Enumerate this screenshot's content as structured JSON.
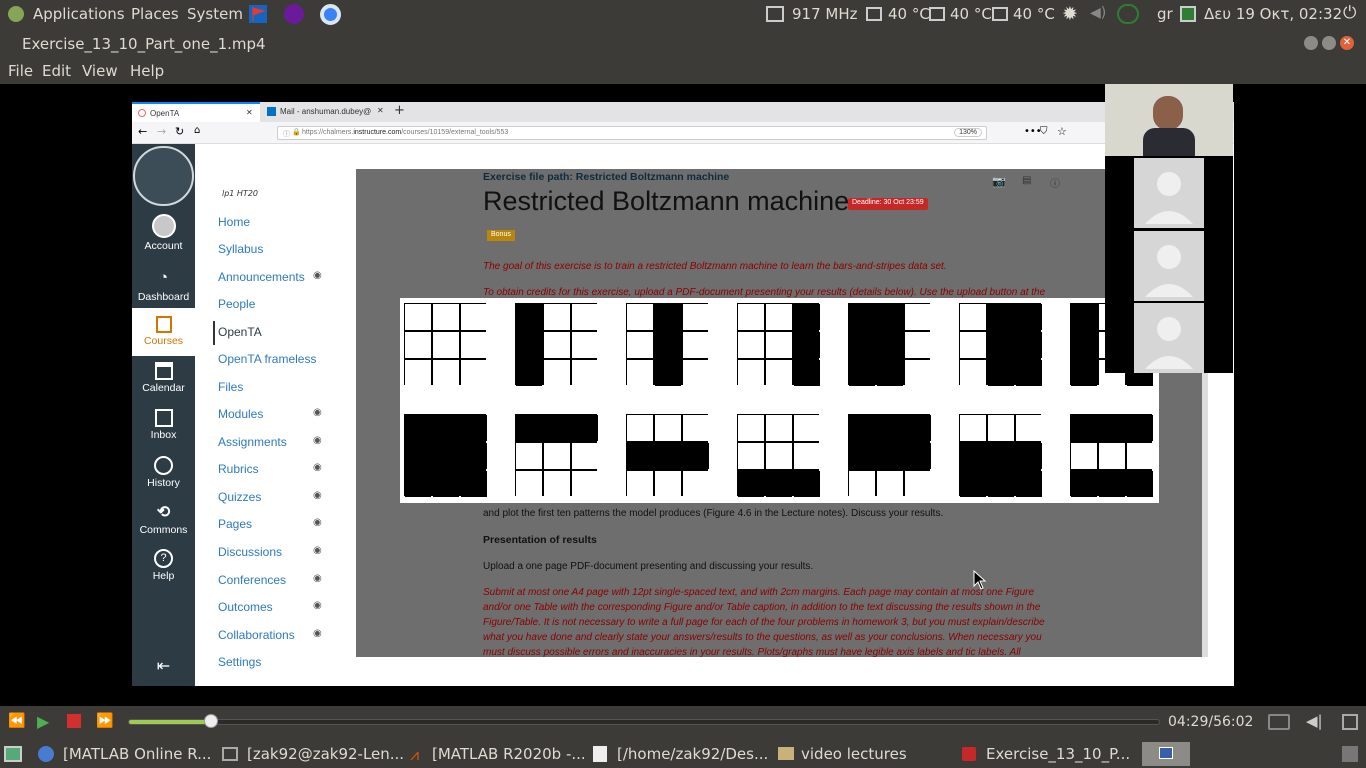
{
  "topbar": {
    "applications": "Applications",
    "places": "Places",
    "system": "System",
    "cpu": "917 MHz",
    "temp1": "40 °C",
    "temp2": "40 °C",
    "temp3": "40 °C",
    "lang": "gr",
    "datetime": "Δευ 19 Οκτ, 02:32"
  },
  "window": {
    "title": "Exercise_13_10_Part_one_1.mp4"
  },
  "menu": {
    "file": "File",
    "edit": "Edit",
    "view": "View",
    "help": "Help"
  },
  "browser": {
    "tab1": "OpenTA",
    "tab2": "Mail - anshuman.dubey@",
    "url_prefix": "https://chalmers.",
    "url_host": "instructure.com",
    "url_path": "/courses/10159/external_tools/553",
    "zoom": "130%"
  },
  "globalnav": {
    "account": "Account",
    "dashboard": "Dashboard",
    "courses": "Courses",
    "calendar": "Calendar",
    "inbox": "Inbox",
    "history": "History",
    "commons": "Commons",
    "help": "Help"
  },
  "coursenav": {
    "term": "lp1 HT20",
    "items": [
      "Home",
      "Syllabus",
      "Announcements",
      "People",
      "OpenTA",
      "OpenTA frameless",
      "Files",
      "Modules",
      "Assignments",
      "Rubrics",
      "Quizzes",
      "Pages",
      "Discussions",
      "Conferences",
      "Outcomes",
      "Collaborations",
      "Settings"
    ]
  },
  "exercise": {
    "path": "Exercise file path: Restricted Boltzmann machine",
    "title": "Restricted Boltzmann machine",
    "deadline": "Deadline: 30 Oct 23:59",
    "bonus": "Bonus",
    "goal": "The goal of this exercise is to train a restricted Boltzmann machine to learn the bars-and-stripes data set.",
    "credits": "To obtain credits for this exercise, upload a PDF-document presenting your results (details below). Use the upload button at the",
    "plot": "and plot the first ten patterns the model produces (Figure 4.6 in the Lecture notes). Discuss your results.",
    "presentation_heading": "Presentation of results",
    "upload": "Upload a one page PDF-document presenting and discussing your results.",
    "submit1": "Submit at most one A4 page with 12pt single-spaced text, and with 2cm margins. Each page may contain at most one Figure",
    "submit2": "and/or one Table with the corresponding Figure and/or Table caption, in addition to the text discussing the results shown in the",
    "submit3": "Figure/Table. It is not necessary to write a full page for each of the four problems in homework 3, but you must explain/describe",
    "submit4": "what you have done and clearly state your answers/results to the questions, as well as your conclusions. When necessary you",
    "submit5": "must discuss possible errors and inaccuracies in your results. Plots/graphs must have legible axis labels and tic labels. All"
  },
  "patterns": {
    "row1": [
      [
        0,
        0,
        0,
        0,
        0,
        0,
        0,
        0,
        0
      ],
      [
        1,
        0,
        0,
        1,
        0,
        0,
        1,
        0,
        0
      ],
      [
        0,
        1,
        0,
        0,
        1,
        0,
        0,
        1,
        0
      ],
      [
        0,
        0,
        1,
        0,
        0,
        1,
        0,
        0,
        1
      ],
      [
        1,
        1,
        0,
        1,
        1,
        0,
        1,
        1,
        0
      ],
      [
        0,
        1,
        1,
        0,
        1,
        1,
        0,
        1,
        1
      ],
      [
        1,
        0,
        1,
        1,
        0,
        1,
        1,
        0,
        1
      ]
    ],
    "row2": [
      [
        1,
        1,
        1,
        1,
        1,
        1,
        1,
        1,
        1
      ],
      [
        1,
        1,
        1,
        0,
        0,
        0,
        0,
        0,
        0
      ],
      [
        0,
        0,
        0,
        1,
        1,
        1,
        0,
        0,
        0
      ],
      [
        0,
        0,
        0,
        0,
        0,
        0,
        1,
        1,
        1
      ],
      [
        1,
        1,
        1,
        1,
        1,
        1,
        0,
        0,
        0
      ],
      [
        0,
        0,
        0,
        1,
        1,
        1,
        1,
        1,
        1
      ],
      [
        1,
        1,
        1,
        0,
        0,
        0,
        1,
        1,
        1
      ]
    ]
  },
  "player": {
    "time": "04:29/56:02",
    "progress": 0.08
  },
  "taskbar": {
    "t1": "[MATLAB Online R...",
    "t2": "[zak92@zak92-Len...",
    "t3": "[MATLAB R2020b -...",
    "t4": "[/home/zak92/Des...",
    "t5": "video lectures",
    "t6": "Exercise_13_10_P..."
  }
}
